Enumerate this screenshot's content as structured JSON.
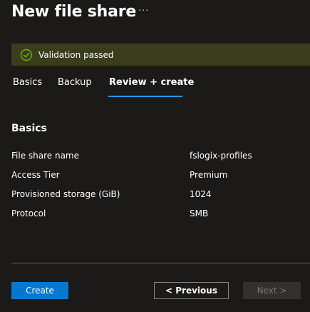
{
  "page": {
    "title": "New file share",
    "more_label": "···"
  },
  "banner": {
    "text": "Validation passed",
    "icon": "check-circle-icon",
    "color": "#393d1b",
    "icon_color": "#6bb700"
  },
  "tabs": [
    {
      "label": "Basics",
      "active": false
    },
    {
      "label": "Backup",
      "active": false
    },
    {
      "label": "Review + create",
      "active": true
    }
  ],
  "section": {
    "heading": "Basics",
    "rows": [
      {
        "label": "File share name",
        "value": "fslogix-profiles"
      },
      {
        "label": "Access Tier",
        "value": "Premium"
      },
      {
        "label": "Provisioned storage (GiB)",
        "value": "1024"
      },
      {
        "label": "Protocol",
        "value": "SMB"
      }
    ]
  },
  "footer": {
    "create_label": "Create",
    "previous_label": "< Previous",
    "next_label": "Next >"
  },
  "colors": {
    "background": "#1b1a19",
    "accent": "#0078d4",
    "tab_underline": "#2899f5"
  }
}
